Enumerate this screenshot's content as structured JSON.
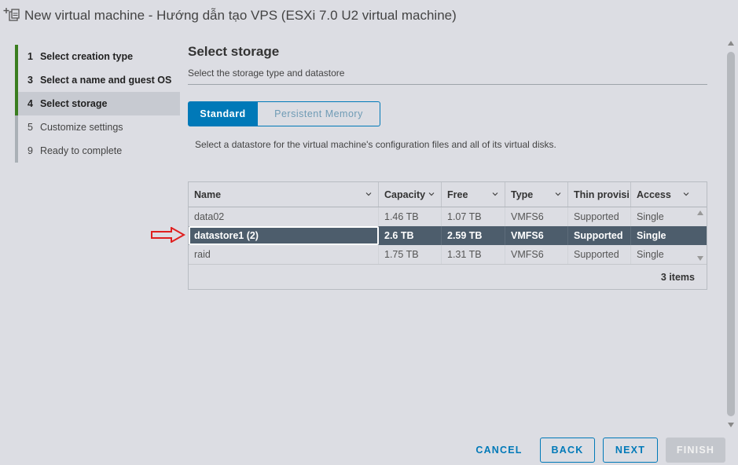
{
  "window": {
    "title": "New virtual machine - Hướng dẫn tạo VPS (ESXi 7.0 U2 virtual machine)"
  },
  "steps": [
    {
      "num": "1",
      "label": "Select creation type",
      "state": "done"
    },
    {
      "num": "3",
      "label": "Select a name and guest OS",
      "state": "done"
    },
    {
      "num": "4",
      "label": "Select storage",
      "state": "active"
    },
    {
      "num": "5",
      "label": "Customize settings",
      "state": "pending"
    },
    {
      "num": "9",
      "label": "Ready to complete",
      "state": "pending"
    }
  ],
  "main": {
    "title": "Select storage",
    "subtitle": "Select the storage type and datastore",
    "tabs": {
      "standard": "Standard",
      "persistent": "Persistent Memory"
    },
    "instruction": "Select a datastore for the virtual machine's configuration files and all of its virtual disks."
  },
  "grid": {
    "columns": {
      "name": "Name",
      "capacity": "Capacity",
      "free": "Free",
      "type": "Type",
      "thin": "Thin provisi",
      "access": "Access"
    },
    "rows": [
      {
        "name": "data02",
        "capacity": "1.46 TB",
        "free": "1.07 TB",
        "type": "VMFS6",
        "thin": "Supported",
        "access": "Single"
      },
      {
        "name": "datastore1 (2)",
        "capacity": "2.6 TB",
        "free": "2.59 TB",
        "type": "VMFS6",
        "thin": "Supported",
        "access": "Single"
      },
      {
        "name": "raid",
        "capacity": "1.75 TB",
        "free": "1.31 TB",
        "type": "VMFS6",
        "thin": "Supported",
        "access": "Single"
      }
    ],
    "footer": "3 items"
  },
  "buttons": {
    "cancel": "CANCEL",
    "back": "BACK",
    "next": "NEXT",
    "finish": "FINISH"
  },
  "colors": {
    "accent": "#0079b8",
    "step_done": "#3a7d1f",
    "selected_row": "#4d5d6c",
    "annotation_arrow": "#e02020"
  },
  "icons": {
    "title": "new-vm-icon",
    "sort": "chevron-down-icon",
    "annotation": "red-arrow-icon"
  }
}
